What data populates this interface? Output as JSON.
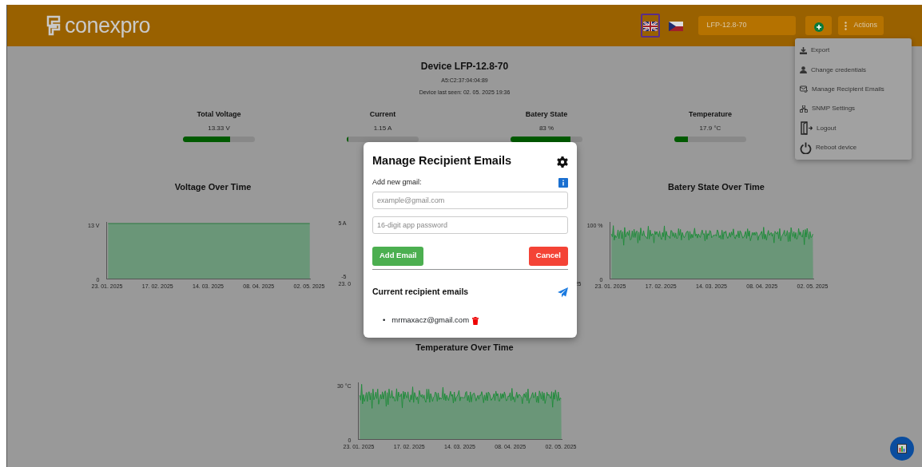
{
  "header": {
    "logo_text": "conexpro",
    "device_select": "LFP-12.8-70",
    "actions_label": "Actions"
  },
  "languages": [
    {
      "kind": "uk",
      "selected": true
    },
    {
      "kind": "cz",
      "selected": false
    }
  ],
  "actions_menu": {
    "expanded": true,
    "items": [
      {
        "kind": "export",
        "label": "Export"
      },
      {
        "kind": "credentials",
        "label": "Change credentials"
      },
      {
        "kind": "emails",
        "label": "Manage Recipient Emails"
      },
      {
        "kind": "snmp",
        "label": "SNMP Settings"
      },
      {
        "kind": "logout",
        "label": "Logout"
      },
      {
        "kind": "reboot",
        "label": "Reboot device"
      }
    ]
  },
  "device": {
    "title": "Device LFP-12.8-70",
    "mac": "A5:C2:37:04:04:89",
    "last_seen": "Device last seen: 02. 05. 2025 19:36"
  },
  "metrics": [
    {
      "label": "Total Voltage",
      "reading": "13.33 V",
      "level": 0.66
    },
    {
      "label": "Current",
      "reading": "1.15 A",
      "level": 0.02
    },
    {
      "label": "Batery State",
      "reading": "83 %",
      "level": 0.83
    },
    {
      "label": "Temperature",
      "reading": "17.9 °C",
      "level": 0.19
    }
  ],
  "charts": [
    {
      "kind": "flat",
      "title": "Voltage Over Time",
      "y_labels": [
        "13 V",
        "0"
      ],
      "x_labels": [
        "23. 01. 2025",
        "17. 02. 2025",
        "14. 03. 2025",
        "08. 04. 2025",
        "02. 05. 2025"
      ]
    },
    {
      "kind": "hidden",
      "y_labels": [
        "5 A",
        "-5"
      ],
      "x_labels": [
        "23. 0",
        "25"
      ]
    },
    {
      "kind": "noisy",
      "title": "Batery State Over Time",
      "y_labels": [
        "100 %",
        "0"
      ],
      "x_labels": [
        "23. 01. 2025",
        "17. 02. 2025",
        "14. 03. 2025",
        "08. 04. 2025",
        "02. 05. 2025"
      ]
    },
    {
      "kind": "noisy",
      "title": "Temperature Over Time",
      "y_labels": [
        "30 °C",
        "0"
      ],
      "x_labels": [
        "23. 01. 2025",
        "17. 02. 2025",
        "14. 03. 2025",
        "08. 04. 2025",
        "02. 05. 2025"
      ]
    }
  ],
  "modal": {
    "title": "Manage Recipient Emails",
    "add_label": "Add new gmail:",
    "email_placeholder": "example@gmail.com",
    "password_placeholder": "16-digit app password",
    "add_button": "Add Email",
    "cancel_button": "Cancel",
    "list_title": "Current recipient emails",
    "recipients": [
      {
        "marker": "•",
        "email": "mrmaxacz@gmail.com"
      }
    ]
  }
}
